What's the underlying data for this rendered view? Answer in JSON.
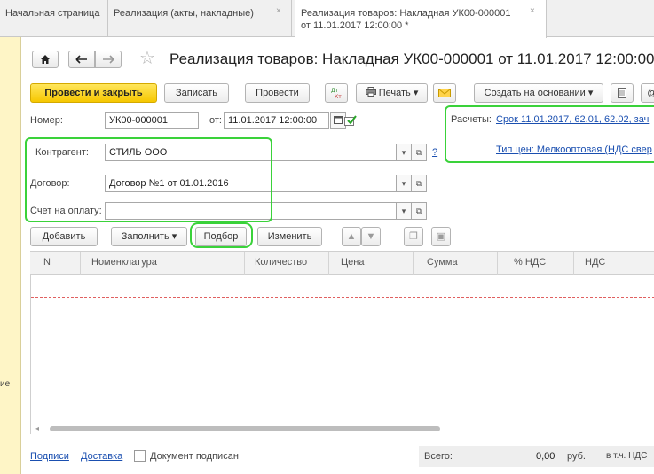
{
  "tabs": [
    {
      "label": "Начальная страница"
    },
    {
      "label": "Реализация (акты, накладные)",
      "close": "×"
    },
    {
      "label_line1": "Реализация товаров: Накладная УК00-000001",
      "label_line2": "от 11.01.2017 12:00:00 *",
      "close": "×"
    }
  ],
  "left_strip": {
    "fragment": "ие"
  },
  "title": "Реализация товаров: Накладная УК00-000001 от 11.01.2017 12:00:00",
  "title_suffix": "*",
  "icons": {
    "home": "home-icon",
    "back": "arrow-left-icon",
    "forward": "arrow-right-icon",
    "favorite": "star-icon"
  },
  "toolbar": {
    "post_close": "Провести и закрыть",
    "save": "Записать",
    "post": "Провести",
    "print": "Печать",
    "create_based": "Создать на основании"
  },
  "form": {
    "number_label": "Номер:",
    "number_value": "УК00-000001",
    "date_label": "от:",
    "date_value": "11.01.2017 12:00:00",
    "counterparty_label": "Контрагент:",
    "counterparty_value": "СТИЛЬ ООО",
    "help": "?",
    "contract_label": "Договор:",
    "contract_value": "Договор №1 от 01.01.2016",
    "invoice_label": "Счет на оплату:",
    "invoice_value": "",
    "settlements_label": "Расчеты:",
    "settlements_link": "Срок 11.01.2017, 62.01, 62.02, зач",
    "price_type_link": "Тип цен: Мелкооптовая (НДС свер"
  },
  "table_toolbar": {
    "add": "Добавить",
    "fill": "Заполнить",
    "pick": "Подбор",
    "change": "Изменить"
  },
  "columns": [
    "N",
    "Номенклатура",
    "Количество",
    "Цена",
    "Сумма",
    "% НДС",
    "НДС"
  ],
  "footer": {
    "signatures": "Подписи",
    "delivery": "Доставка",
    "signed_label": "Документ подписан",
    "total_label": "Всего:",
    "total_value": "0,00",
    "currency": "руб.",
    "vat_label": "в т.ч. НДС"
  },
  "colors": {
    "accent_yellow": "#f6c700",
    "highlight_green": "#3ad23a",
    "link_blue": "#1a4fb0"
  }
}
